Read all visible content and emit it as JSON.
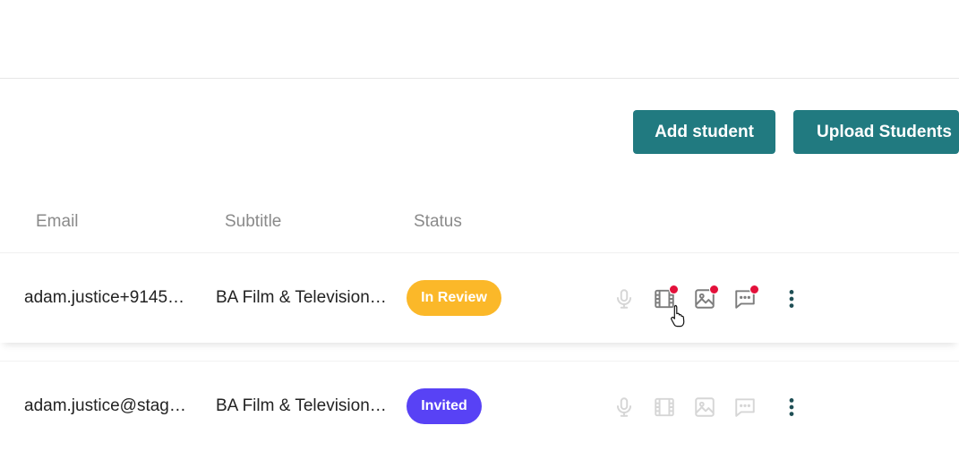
{
  "toolbar": {
    "add_student_label": "Add student",
    "upload_students_label": "Upload Students",
    "button_color": "#217a80"
  },
  "table": {
    "headers": [
      "Email",
      "Subtitle",
      "Status"
    ],
    "rows": [
      {
        "email": "adam.justice+9145…",
        "subtitle": "BA Film & Television…",
        "status": "In Review",
        "status_color": "#fbb829",
        "actions": [
          "mic-icon",
          "film-icon",
          "image-icon",
          "chat-icon",
          "more-vertical-icon"
        ]
      },
      {
        "email": "adam.justice@stag…",
        "subtitle": "BA Film & Television…",
        "status": "Invited",
        "status_color": "#5842f5",
        "actions": [
          "mic-icon",
          "film-icon",
          "image-icon",
          "chat-icon",
          "more-vertical-icon"
        ]
      }
    ]
  },
  "notification_dot_color": "#e3103a"
}
